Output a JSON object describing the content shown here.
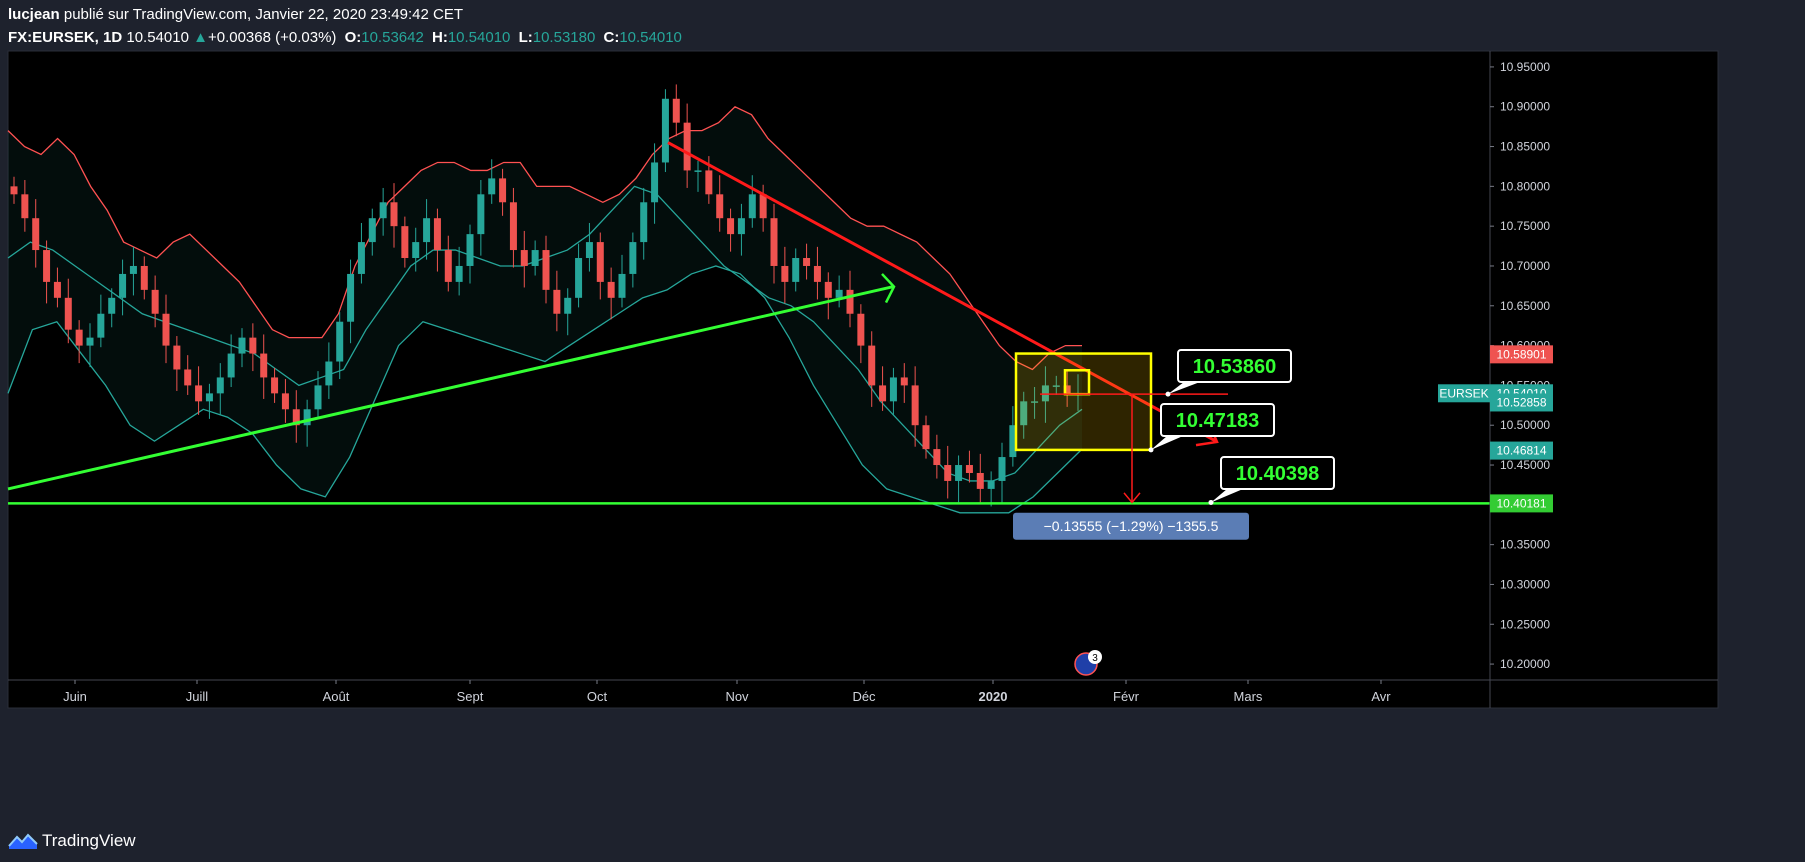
{
  "header": {
    "author": "lucjean",
    "published": "publié sur TradingView.com, Janvier 22, 2020 23:49:42 CET",
    "symbol": "FX:EURSEK, 1D",
    "last": "10.54010",
    "change": "+0.00368 (+0.03%)",
    "o_label": "O:",
    "o_value": "10.53642",
    "h_label": "H:",
    "h_value": "10.54010",
    "l_label": "L:",
    "l_value": "10.53180",
    "c_label": "C:",
    "c_value": "10.54010"
  },
  "footer": {
    "brand": "TradingView"
  },
  "colors": {
    "up": "#26a69a",
    "down": "#ef5350",
    "band_upper": "#ff5252",
    "band_mid": "#26a69a",
    "trend_green": "#33ff33",
    "trend_red": "#ff1a1a",
    "box": "#ffff00",
    "bg": "#000000"
  },
  "chart_data": {
    "type": "candlestick",
    "title": "FX:EURSEK, 1D",
    "ylim": [
      10.18,
      10.97
    ],
    "y_ticks": [
      "10.95000",
      "10.90000",
      "10.85000",
      "10.80000",
      "10.75000",
      "10.70000",
      "10.65000",
      "10.60000",
      "10.55000",
      "10.50000",
      "10.45000",
      "10.40000",
      "10.35000",
      "10.30000",
      "10.25000",
      "10.20000"
    ],
    "x_months": [
      "Juin",
      "Juill",
      "Août",
      "Sept",
      "Oct",
      "Nov",
      "Déc",
      "2020",
      "Févr",
      "Mars",
      "Avr"
    ],
    "price_badges": [
      {
        "label": "",
        "value": "10.58901",
        "color": "#ef5350"
      },
      {
        "label": "EURSEK",
        "value": "10.54010",
        "color": "#26a69a"
      },
      {
        "label": "",
        "value": "10.52858",
        "color": "#26a69a"
      },
      {
        "label": "",
        "value": "10.46814",
        "color": "#26a69a"
      },
      {
        "label": "",
        "value": "10.40181",
        "color": "#33cc33"
      }
    ],
    "annotations": [
      "10.53860",
      "10.47183",
      "10.40398"
    ],
    "measure_label": "−0.13555 (−1.29%) −1355.5",
    "event_badge": "3",
    "series": [
      {
        "name": "EURSEK close",
        "values": [
          10.79,
          10.76,
          10.72,
          10.68,
          10.66,
          10.62,
          10.6,
          10.61,
          10.64,
          10.66,
          10.69,
          10.7,
          10.67,
          10.64,
          10.6,
          10.57,
          10.55,
          10.53,
          10.54,
          10.56,
          10.59,
          10.61,
          10.59,
          10.56,
          10.54,
          10.52,
          10.5,
          10.52,
          10.55,
          10.58,
          10.63,
          10.69,
          10.73,
          10.76,
          10.78,
          10.75,
          10.71,
          10.73,
          10.76,
          10.72,
          10.68,
          10.7,
          10.74,
          10.79,
          10.81,
          10.78,
          10.72,
          10.7,
          10.72,
          10.67,
          10.64,
          10.66,
          10.71,
          10.73,
          10.68,
          10.66,
          10.69,
          10.73,
          10.78,
          10.83,
          10.91,
          10.88,
          10.82,
          10.82,
          10.79,
          10.76,
          10.74,
          10.76,
          10.79,
          10.76,
          10.7,
          10.68,
          10.71,
          10.7,
          10.68,
          10.66,
          10.67,
          10.64,
          10.6,
          10.55,
          10.53,
          10.56,
          10.55,
          10.5,
          10.47,
          10.45,
          10.43,
          10.45,
          10.44,
          10.42,
          10.43,
          10.46,
          10.5,
          10.53,
          10.53,
          10.55,
          10.55,
          10.54,
          10.54
        ]
      },
      {
        "name": "Bollinger upper",
        "values": [
          10.87,
          10.85,
          10.84,
          10.86,
          10.84,
          10.8,
          10.77,
          10.73,
          10.72,
          10.71,
          10.73,
          10.74,
          10.72,
          10.7,
          10.68,
          10.65,
          10.62,
          10.61,
          10.61,
          10.61,
          10.64,
          10.7,
          10.74,
          10.78,
          10.8,
          10.82,
          10.83,
          10.83,
          10.82,
          10.82,
          10.83,
          10.83,
          10.8,
          10.8,
          10.8,
          10.79,
          10.78,
          10.79,
          10.81,
          10.84,
          10.86,
          10.87,
          10.87,
          10.88,
          10.9,
          10.89,
          10.86,
          10.84,
          10.82,
          10.8,
          10.78,
          10.76,
          10.75,
          10.75,
          10.74,
          10.73,
          10.71,
          10.69,
          10.66,
          10.63,
          10.6,
          10.58,
          10.57,
          10.59,
          10.6,
          10.6
        ]
      },
      {
        "name": "Bollinger middle",
        "values": [
          10.71,
          10.73,
          10.72,
          10.7,
          10.68,
          10.66,
          10.64,
          10.63,
          10.62,
          10.61,
          10.6,
          10.59,
          10.57,
          10.55,
          10.56,
          10.57,
          10.62,
          10.66,
          10.7,
          10.72,
          10.72,
          10.71,
          10.7,
          10.7,
          10.71,
          10.72,
          10.74,
          10.77,
          10.8,
          10.79,
          10.76,
          10.73,
          10.7,
          10.68,
          10.66,
          10.65,
          10.63,
          10.6,
          10.57,
          10.53,
          10.5,
          10.47,
          10.44,
          10.43,
          10.43,
          10.44,
          10.47,
          10.5,
          10.52
        ]
      },
      {
        "name": "Bollinger lower",
        "values": [
          10.54,
          10.62,
          10.63,
          10.59,
          10.55,
          10.5,
          10.48,
          10.5,
          10.52,
          10.51,
          10.49,
          10.45,
          10.42,
          10.41,
          10.46,
          10.53,
          10.6,
          10.63,
          10.62,
          10.61,
          10.6,
          10.59,
          10.58,
          10.6,
          10.62,
          10.64,
          10.66,
          10.67,
          10.69,
          10.7,
          10.69,
          10.66,
          10.61,
          10.55,
          10.5,
          10.45,
          10.42,
          10.41,
          10.4,
          10.39,
          10.39,
          10.39,
          10.41,
          10.44,
          10.47
        ]
      }
    ]
  }
}
